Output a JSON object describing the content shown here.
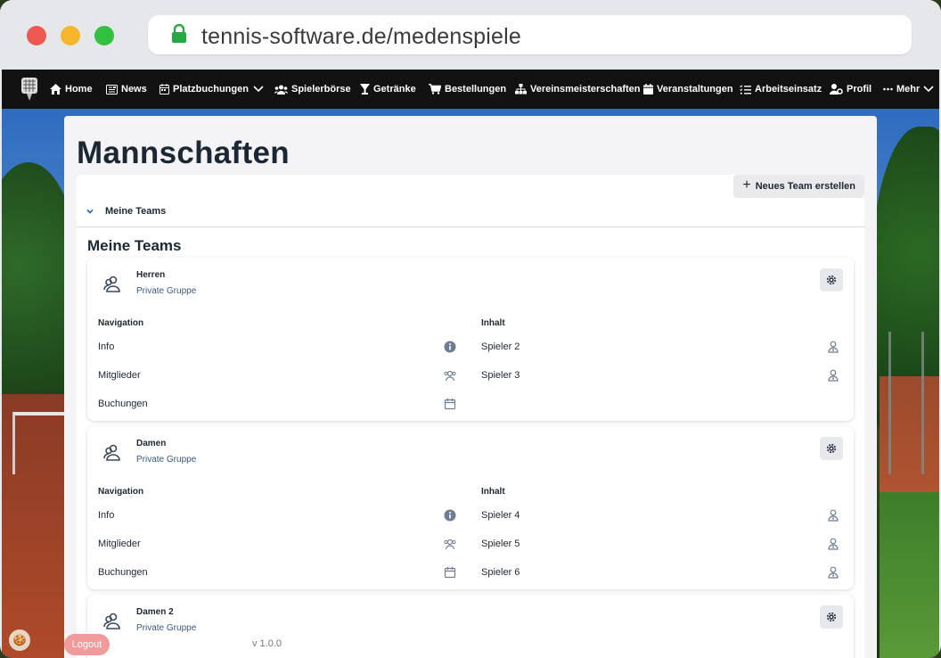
{
  "browser": {
    "url": "tennis-software.de/medenspiele"
  },
  "nav": {
    "items": [
      {
        "label": "Home",
        "icon": "home-icon"
      },
      {
        "label": "News",
        "icon": "news-icon"
      },
      {
        "label": "Platzbuchungen",
        "icon": "calendar-icon"
      },
      {
        "label": "Spielerbörse",
        "icon": "users-icon"
      },
      {
        "label": "Getränke",
        "icon": "glass-icon"
      },
      {
        "label": "Bestellungen",
        "icon": "cart-icon"
      },
      {
        "label": "Vereinsmeisterschaften",
        "icon": "sitemap-icon"
      },
      {
        "label": "Veranstaltungen",
        "icon": "calendar-day-icon"
      },
      {
        "label": "Arbeitseinsatz",
        "icon": "list-check-icon"
      },
      {
        "label": "Profil",
        "icon": "user-gear-icon"
      },
      {
        "label": "Mehr",
        "icon": "ellipsis-icon"
      }
    ]
  },
  "page": {
    "title": "Mannschaften",
    "new_team_label": "Neues Team erstellen",
    "section_toggle_label": "Meine Teams",
    "section_heading": "Meine Teams"
  },
  "teams": [
    {
      "name": "Herren",
      "subtitle": "Private Gruppe",
      "nav_header": "Navigation",
      "content_header": "Inhalt",
      "nav": [
        "Info",
        "Mitglieder",
        "Buchungen"
      ],
      "content": [
        "Spieler 2",
        "Spieler 3"
      ]
    },
    {
      "name": "Damen",
      "subtitle": "Private Gruppe",
      "nav_header": "Navigation",
      "content_header": "Inhalt",
      "nav": [
        "Info",
        "Mitglieder",
        "Buchungen"
      ],
      "content": [
        "Spieler 4",
        "Spieler 5",
        "Spieler 6"
      ]
    },
    {
      "name": "Damen 2",
      "subtitle": "Private Gruppe"
    }
  ],
  "footer": {
    "version": "v 1.0.0",
    "logout_label": "Logout"
  },
  "colors": {
    "navbar": "#121212",
    "title": "#1b2733",
    "link": "#3a5878",
    "logout": "#f19a9a"
  }
}
